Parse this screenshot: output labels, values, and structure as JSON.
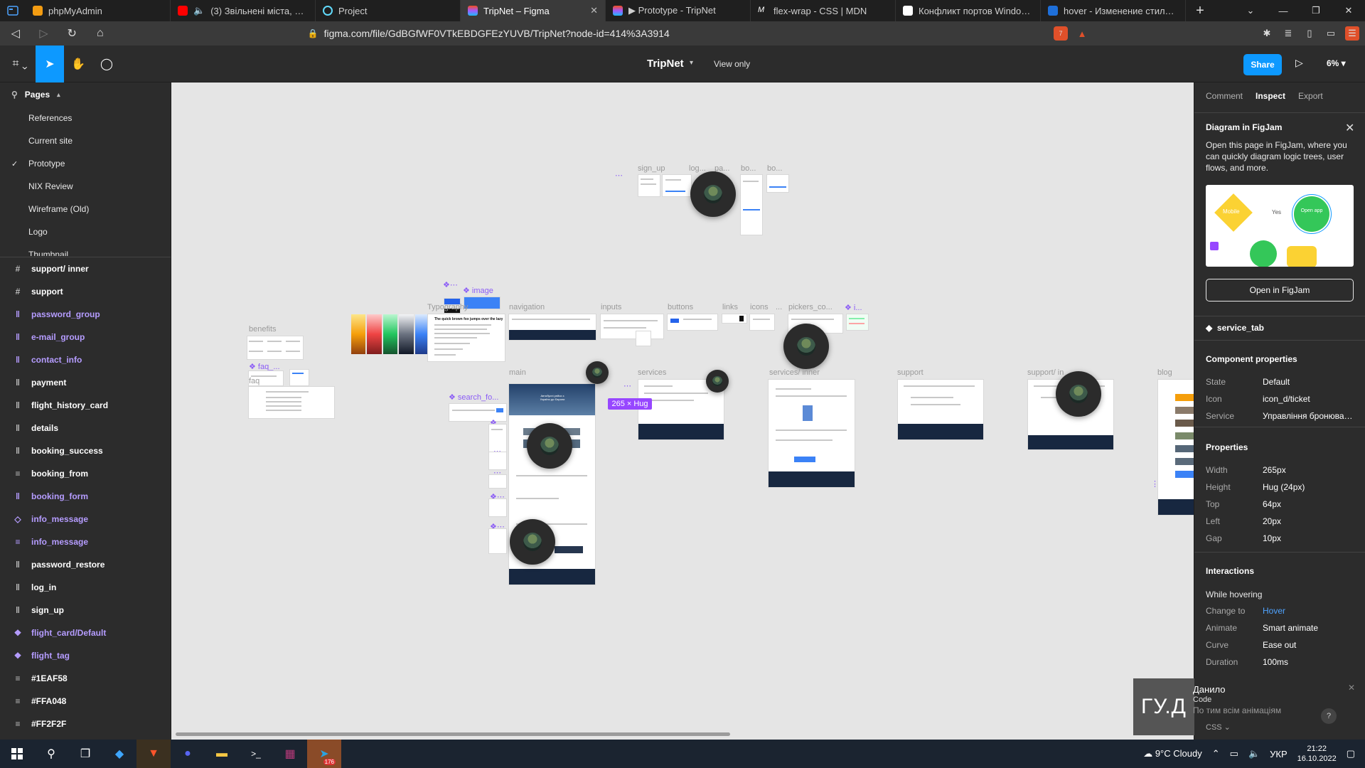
{
  "browser": {
    "tabs": [
      {
        "label": "phpMyAdmin",
        "color": "#f39c12",
        "active": false
      },
      {
        "label": "(3) Звільнені міста, трупи с",
        "color": "#ff0000",
        "active": false
      },
      {
        "label": "Project",
        "color": "#61dafb",
        "active": false
      },
      {
        "label": "TripNet – Figma",
        "color": "#a259ff",
        "active": true
      },
      {
        "label": "▶ Prototype - TripNet",
        "color": "#a259ff",
        "active": false
      },
      {
        "label": "flex-wrap - CSS | MDN",
        "color": "#ffffff",
        "active": false
      },
      {
        "label": "Конфликт портов Windows, ка",
        "color": "#ffffff",
        "active": false
      },
      {
        "label": "hover - Изменение стиля одно",
        "color": "#1e6fd9",
        "active": false
      }
    ],
    "url": "figma.com/file/GdBGfWF0VTkEBDGFEzYUVB/TripNet?node-id=414%3A3914",
    "brave_badge": "7"
  },
  "figma": {
    "title": "TripNet",
    "view_only": "View only",
    "share": "Share",
    "zoom": "6%"
  },
  "left_panel": {
    "pages_heading": "Pages",
    "pages": [
      {
        "label": "References",
        "checked": false
      },
      {
        "label": "Current site",
        "checked": false
      },
      {
        "label": "Prototype",
        "checked": true
      },
      {
        "label": "NIX Review",
        "checked": false
      },
      {
        "label": "Wireframe (Old)",
        "checked": false
      },
      {
        "label": "Logo",
        "checked": false
      },
      {
        "label": "Thumbnail",
        "checked": false
      }
    ],
    "layers": [
      {
        "label": "support/ inner",
        "icon": "#",
        "component": false
      },
      {
        "label": "support",
        "icon": "#",
        "component": false
      },
      {
        "label": "password_group",
        "icon": "ǁ",
        "component": true
      },
      {
        "label": "e-mail_group",
        "icon": "ǁ",
        "component": true
      },
      {
        "label": "contact_info",
        "icon": "ǁ",
        "component": true
      },
      {
        "label": "payment",
        "icon": "ǁ",
        "component": false
      },
      {
        "label": "flight_history_card",
        "icon": "ǁ",
        "component": false
      },
      {
        "label": "details",
        "icon": "ǁ",
        "component": false
      },
      {
        "label": "booking_success",
        "icon": "ǁ",
        "component": false
      },
      {
        "label": "booking_from",
        "icon": "≡",
        "component": false
      },
      {
        "label": "booking_form",
        "icon": "ǁ",
        "component": true
      },
      {
        "label": "info_message",
        "icon": "◇",
        "component": true
      },
      {
        "label": "info_message",
        "icon": "≡",
        "component": true
      },
      {
        "label": "password_restore",
        "icon": "ǁ",
        "component": false
      },
      {
        "label": "log_in",
        "icon": "ǁ",
        "component": false
      },
      {
        "label": "sign_up",
        "icon": "ǁ",
        "component": false
      },
      {
        "label": "flight_card/Default",
        "icon": "❖",
        "component": true
      },
      {
        "label": "flight_tag",
        "icon": "❖",
        "component": true
      },
      {
        "label": "#1EAF58",
        "icon": "≡",
        "component": false
      },
      {
        "label": "#FFA048",
        "icon": "≡",
        "component": false
      },
      {
        "label": "#FF2F2F",
        "icon": "≡",
        "component": false
      }
    ]
  },
  "canvas": {
    "labels": {
      "sign_up": "sign_up",
      "log": "log...",
      "pa": "pa...",
      "bo1": "bo...",
      "bo2": "bo...",
      "image": "image",
      "typography": "Typography",
      "navigation": "navigation",
      "inputs": "inputs",
      "buttons": "buttons",
      "links": "links",
      "icons": "icons",
      "dots": "...",
      "pickers": "pickers_co...",
      "i": "i...",
      "benefits": "benefits",
      "faq_comp": "faq_...",
      "faq": "faq",
      "main": "main",
      "search_fo": "search_fo...",
      "services": "services",
      "services_inner": "services/ inner",
      "support": "support",
      "support_inner": "support/ in",
      "blog": "blog"
    },
    "size_badge": "265 × Hug",
    "hero_text": "Автобусні рейси з України до Європи",
    "typography_sample": "The quick brown fox jumps over the lazy"
  },
  "right_panel": {
    "tabs": [
      "Comment",
      "Inspect",
      "Export"
    ],
    "active_tab": "Inspect",
    "figjam": {
      "title": "Diagram in FigJam",
      "description": "Open this page in FigJam, where you can quickly diagram logic trees, user flows, and more.",
      "mobile": "Mobile",
      "yes": "Yes",
      "open_app": "Open app",
      "button": "Open in FigJam"
    },
    "component_name": "service_tab",
    "component_props_title": "Component properties",
    "component_props": [
      {
        "k": "State",
        "v": "Default"
      },
      {
        "k": "Icon",
        "v": "icon_d/ticket"
      },
      {
        "k": "Service",
        "v": "Управління бронюван..."
      }
    ],
    "properties_title": "Properties",
    "properties": [
      {
        "k": "Width",
        "v": "265px"
      },
      {
        "k": "Height",
        "v": "Hug (24px)"
      },
      {
        "k": "Top",
        "v": "64px"
      },
      {
        "k": "Left",
        "v": "20px"
      },
      {
        "k": "Gap",
        "v": "10px"
      }
    ],
    "interactions_title": "Interactions",
    "trigger": "While hovering",
    "interactions": [
      {
        "k": "Change to",
        "v": "Hover",
        "link": true
      },
      {
        "k": "Animate",
        "v": "Smart animate",
        "link": false
      },
      {
        "k": "Curve",
        "v": "Ease out",
        "link": false
      },
      {
        "k": "Duration",
        "v": "100ms",
        "link": false
      }
    ]
  },
  "video": {
    "initials": "ГУ.Д",
    "name": "Данило",
    "code": "Code",
    "sub": "По тим всім анімаціям",
    "css": "CSS"
  },
  "taskbar": {
    "weather": "9°C  Cloudy",
    "lang": "УКР",
    "time": "21:22",
    "date": "16.10.2022",
    "telegram_badge": "176"
  }
}
